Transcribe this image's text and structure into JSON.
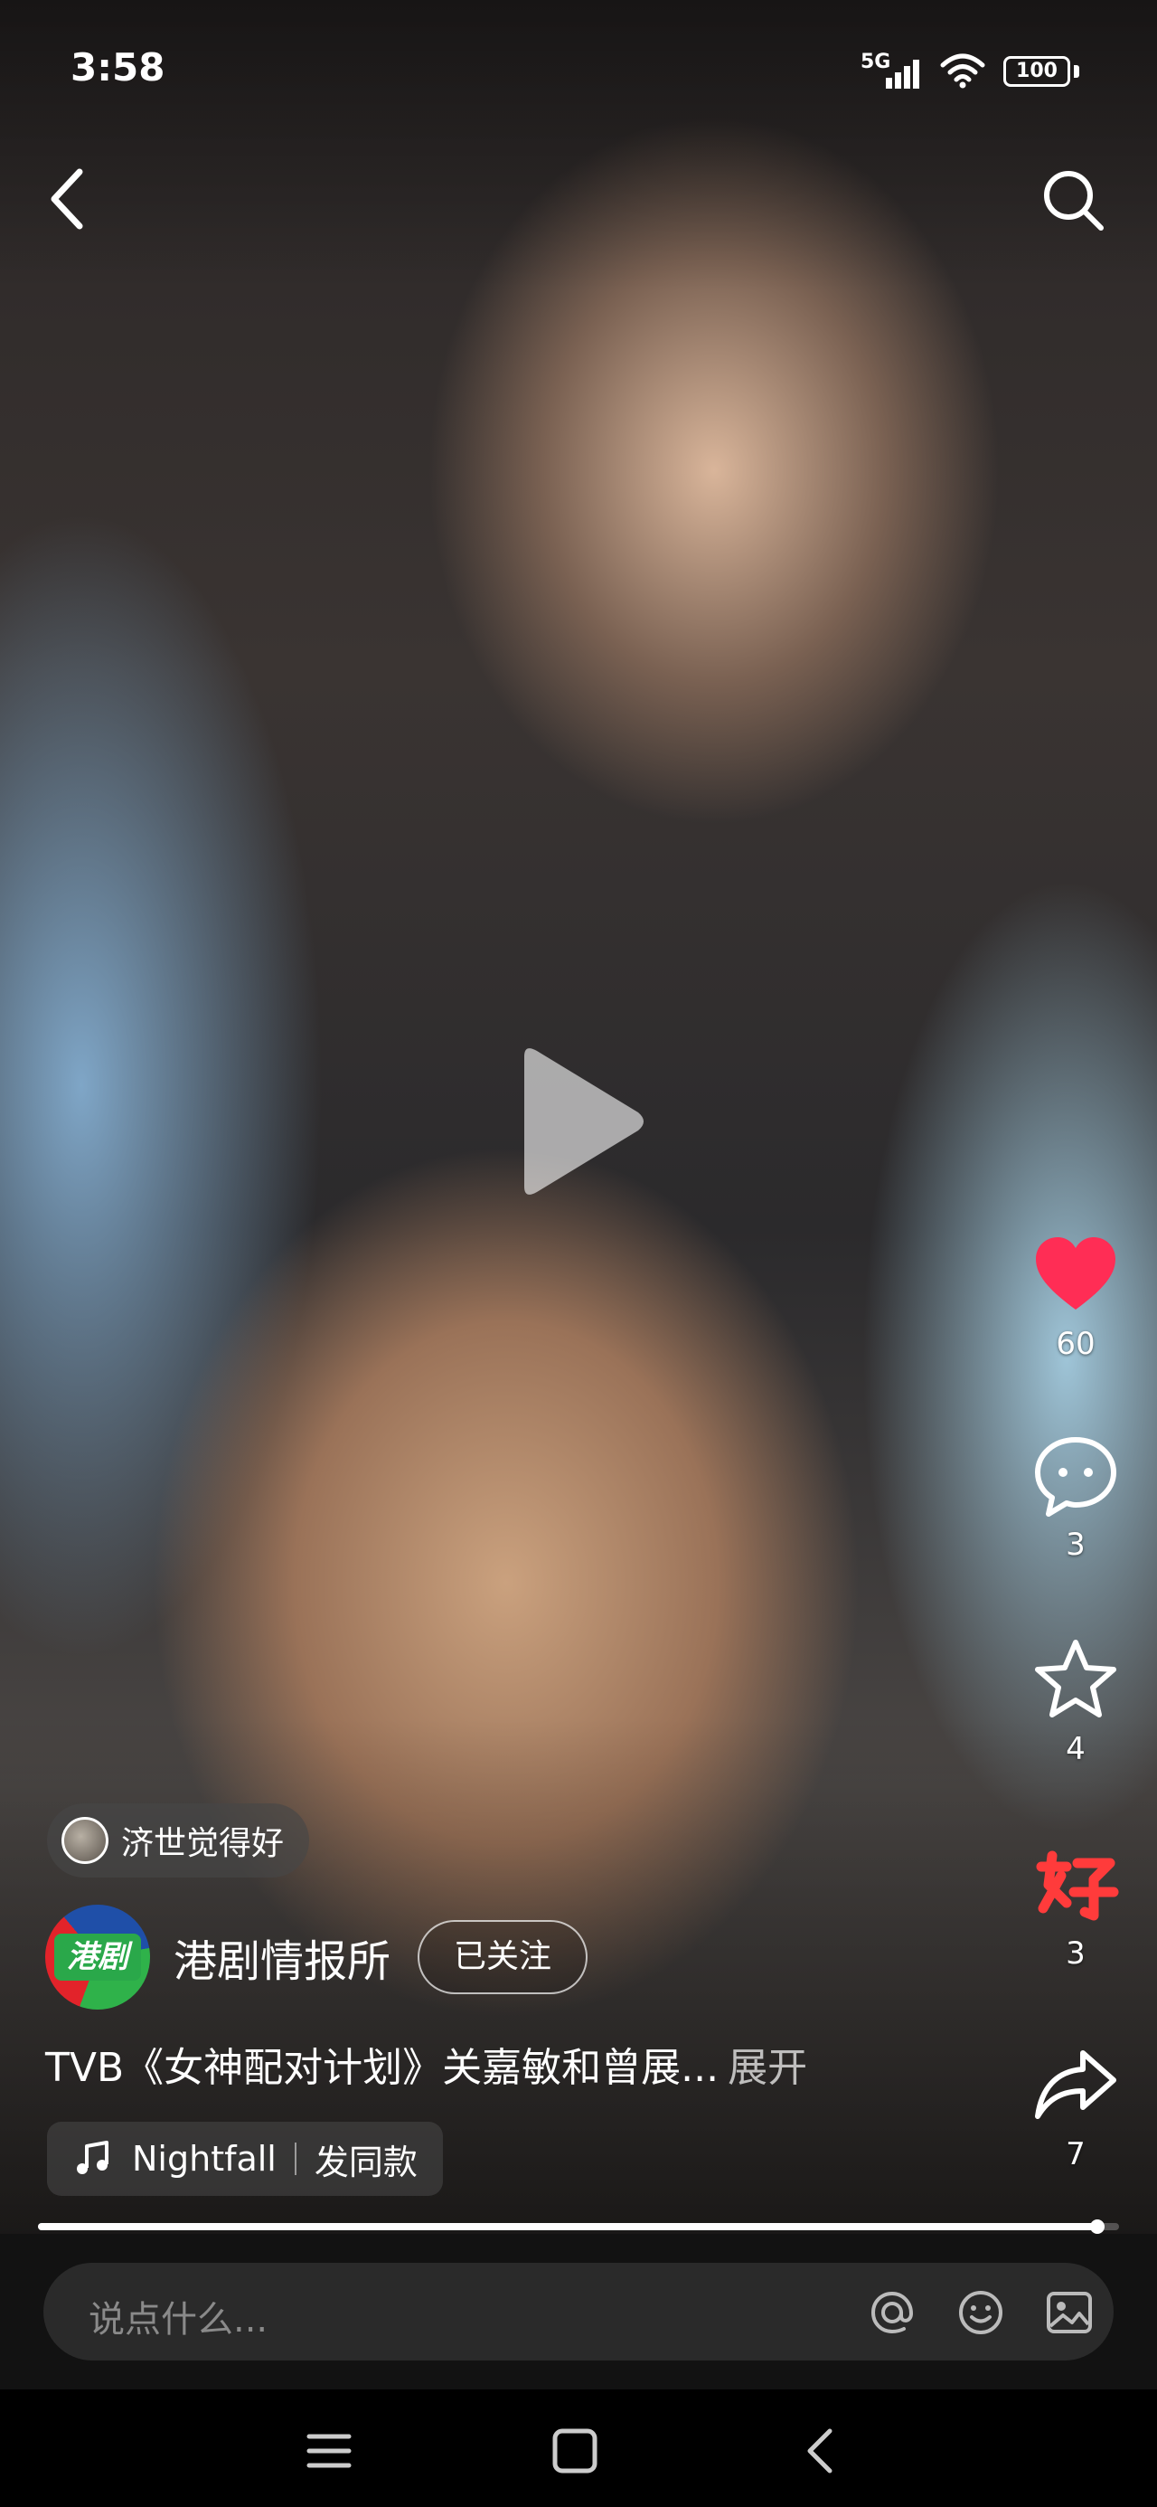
{
  "status_bar": {
    "time": "3:58",
    "network": "5G",
    "battery": "100"
  },
  "actions": {
    "like_count": "60",
    "comment_count": "3",
    "favorite_count": "4",
    "good_count": "3",
    "share_count": "7"
  },
  "topic": {
    "label": "济世觉得好"
  },
  "author": {
    "avatar_text": "港剧",
    "name": "港剧情报所",
    "follow_label": "已关注"
  },
  "caption": {
    "text": "TVB《女神配对计划》关嘉敏和曾展...",
    "expand": "展开"
  },
  "music": {
    "title": "Nightfall",
    "action": "发同款"
  },
  "progress": {
    "fraction": 0.98
  },
  "comment": {
    "placeholder": "说点什么..."
  },
  "colors": {
    "like": "#ff2d55",
    "good_badge": "#ff3b3b",
    "brand_green": "#2aa84a"
  }
}
